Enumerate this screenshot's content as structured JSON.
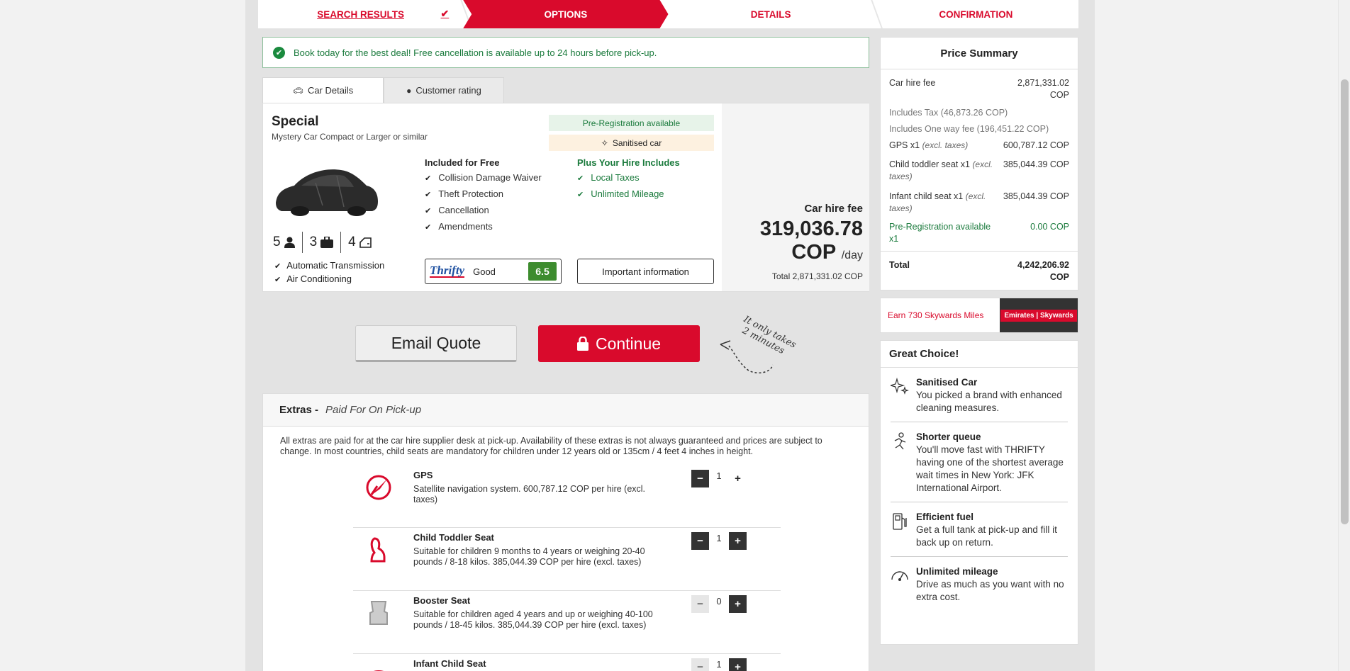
{
  "steps": [
    {
      "label": "SEARCH RESULTS",
      "state": "done"
    },
    {
      "label": "OPTIONS",
      "state": "active"
    },
    {
      "label": "DETAILS",
      "state": "pending"
    },
    {
      "label": "CONFIRMATION",
      "state": "pending"
    }
  ],
  "notice": "Book today for the best deal! Free cancellation is available up to 24 hours before pick-up.",
  "tabs": {
    "car_details": "Car Details",
    "customer_rating": "Customer rating"
  },
  "car": {
    "title": "Special",
    "subtitle": "Mystery Car Compact or Larger or similar",
    "seats": "5",
    "bags": "3",
    "doors": "4",
    "features": [
      "Automatic Transmission",
      "Air Conditioning"
    ],
    "badge_prereg": "Pre-Registration available",
    "badge_sanitised": "Sanitised car",
    "included_title": "Included for Free",
    "included": [
      "Collision Damage Waiver",
      "Theft Protection",
      "Cancellation",
      "Amendments"
    ],
    "plus_title": "Plus Your Hire Includes",
    "plus": [
      "Local Taxes",
      "Unlimited Mileage"
    ],
    "supplier_logo": "Thrifty",
    "supplier_rating": "Good",
    "supplier_score": "6.5",
    "important_info": "Important information",
    "price_label": "Car hire fee",
    "price_amount": "319,036.78",
    "price_currency": "COP",
    "price_per": "/day",
    "price_total": "Total 2,871,331.02 COP"
  },
  "actions": {
    "email": "Email Quote",
    "continue": "Continue",
    "note": "It only takes 2 minutes"
  },
  "extras": {
    "title": "Extras -",
    "subtitle": "Paid For On Pick-up",
    "description": "All extras are paid for at the car hire supplier desk at pick-up. Availability of these extras is not always guaranteed and prices are subject to change. In most countries, child seats are mandatory for children under 12 years old or 135cm / 4 feet 4 inches in height.",
    "items": [
      {
        "name": "GPS",
        "text": "Satellite navigation system. 600,787.12 COP per hire (excl. taxes)",
        "qty": "1",
        "icon": "gps-icon"
      },
      {
        "name": "Child Toddler Seat",
        "text": "Suitable for children 9 months to 4 years or weighing 20-40 pounds / 8-18 kilos. 385,044.39 COP per hire (excl. taxes)",
        "qty": "1",
        "icon": "toddler-seat-icon"
      },
      {
        "name": "Booster Seat",
        "text": "Suitable for children aged 4 years and up or weighing 40-100 pounds / 18-45 kilos. 385,044.39 COP per hire (excl. taxes)",
        "qty": "0",
        "icon": "booster-seat-icon"
      },
      {
        "name": "Infant Child Seat",
        "text": "",
        "qty": "1",
        "icon": "infant-seat-icon"
      }
    ]
  },
  "summary": {
    "title": "Price Summary",
    "car_hire_label": "Car hire fee",
    "car_hire_value": "2,871,331.02 COP",
    "tax": "Includes Tax (46,873.26 COP)",
    "oneway": "Includes One way fee (196,451.22 COP)",
    "gps_label": "GPS x1",
    "gps_value": "600,787.12 COP",
    "toddler_label": "Child toddler seat x1",
    "toddler_value": "385,044.39 COP",
    "infant_label": "Infant child seat x1",
    "infant_value": "385,044.39 COP",
    "excl": "(excl. taxes)",
    "prereg_label": "Pre-Registration available x1",
    "prereg_value": "0.00 COP",
    "total_label": "Total",
    "total_value": "4,242,206.92 COP"
  },
  "skywards": {
    "earn": "Earn 730 Skywards Miles",
    "logo": "Emirates | Skywards"
  },
  "great_choice": {
    "title": "Great Choice!",
    "items": [
      {
        "title": "Sanitised Car",
        "text": "You picked a brand with enhanced cleaning measures."
      },
      {
        "title": "Shorter queue",
        "text": "You'll move fast with THRIFTY having one of the shortest average wait times in New York: JFK International Airport."
      },
      {
        "title": "Efficient fuel",
        "text": "Get a full tank at pick-up and fill it back up on return."
      },
      {
        "title": "Unlimited mileage",
        "text": "Drive as much as you want with no extra cost."
      }
    ]
  },
  "colors": {
    "brand": "#d90a2c",
    "green": "#1a7a3c",
    "score": "#3d8c2e"
  }
}
